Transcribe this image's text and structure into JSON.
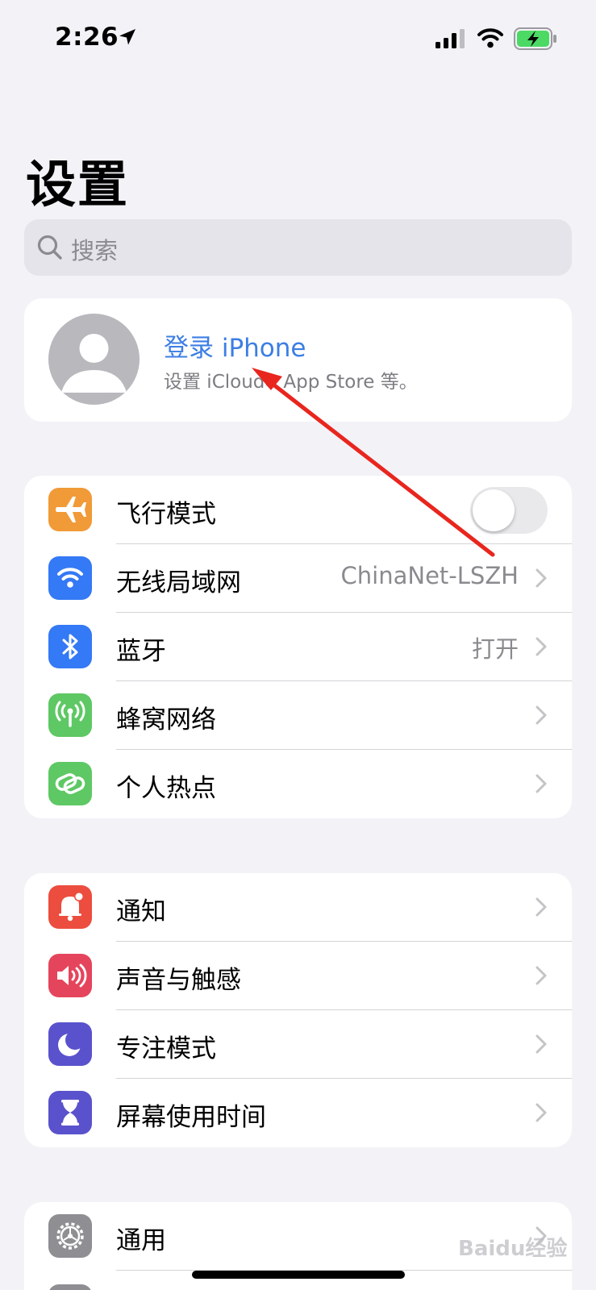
{
  "status_bar": {
    "time": "2:26",
    "location_icon": "location-arrow-icon",
    "signal_icon": "cellular-signal-icon",
    "wifi_icon": "wifi-icon",
    "battery_icon": "battery-charging-icon",
    "battery_color": "#4cd964"
  },
  "header": {
    "title": "设置"
  },
  "search": {
    "placeholder": "搜索",
    "icon": "search-icon"
  },
  "profile": {
    "title": "登录 iPhone",
    "subtitle": "设置 iCloud、App Store 等。",
    "title_color": "#3c7ee4"
  },
  "groups": [
    {
      "rows": [
        {
          "label": "飞行模式",
          "icon": "airplane-icon",
          "icon_bg": "#f19a38",
          "toggle": false
        },
        {
          "label": "无线局域网",
          "icon": "wifi-icon",
          "icon_bg": "#3479f5",
          "value": "ChinaNet-LSZH"
        },
        {
          "label": "蓝牙",
          "icon": "bluetooth-icon",
          "icon_bg": "#3479f5",
          "value": "打开"
        },
        {
          "label": "蜂窝网络",
          "icon": "cellular-antenna-icon",
          "icon_bg": "#5ec864"
        },
        {
          "label": "个人热点",
          "icon": "hotspot-icon",
          "icon_bg": "#5ec864"
        }
      ]
    },
    {
      "rows": [
        {
          "label": "通知",
          "icon": "bell-icon",
          "icon_bg": "#ec4d3e"
        },
        {
          "label": "声音与触感",
          "icon": "speaker-icon",
          "icon_bg": "#e5455c"
        },
        {
          "label": "专注模式",
          "icon": "moon-icon",
          "icon_bg": "#5a52cc"
        },
        {
          "label": "屏幕使用时间",
          "icon": "hourglass-icon",
          "icon_bg": "#5a52cc"
        }
      ]
    },
    {
      "rows": [
        {
          "label": "通用",
          "icon": "gear-icon",
          "icon_bg": "#8e8e93"
        }
      ]
    }
  ],
  "annotation": {
    "arrow_color": "#e8261e"
  },
  "watermark": {
    "text": "Baidu经验"
  }
}
